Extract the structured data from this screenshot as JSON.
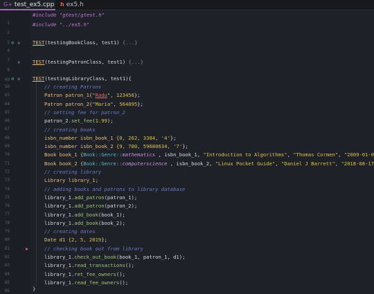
{
  "tabs": [
    {
      "label": "test_ex5.cpp",
      "icon": "cpp-file-icon",
      "active": true
    },
    {
      "label": "ex5.h",
      "icon": "header-file-icon",
      "active": false
    }
  ],
  "line_numbers": [
    "1",
    "2",
    "3",
    "4",
    "7",
    "8",
    "49",
    "50",
    "63",
    "64",
    "65",
    "66",
    "67",
    "68",
    "69",
    "70",
    "71",
    "72",
    "73",
    "74",
    "75",
    "76",
    "77",
    "78",
    "79",
    "80",
    "81",
    "82",
    "83",
    "84",
    "85",
    "86",
    "87",
    "88"
  ],
  "code": {
    "include1": "#include \"gtest/gtest.h\"",
    "include2": "#include \"../ex5.h\"",
    "test1_macro": "TEST",
    "test1_args": "(testingBookClass, test1)",
    "fold": "{...}",
    "test2_macro": "TEST",
    "test2_args": "(testingPatronClass, test1)",
    "test3_macro": "TEST",
    "test3_args": "(testingLibraryClass, test1){",
    "c_patrons": "// creating Patrons",
    "patron1_a": "Patron patron_1{\"",
    "patron1_name": "Radu",
    "patron1_b": "\", ",
    "patron1_num": "123456",
    "patron1_c": "};",
    "patron2_a": "Patron patron_2{\"",
    "patron2_name": "Maria",
    "patron2_b": "\", ",
    "patron2_num": "564895",
    "patron2_c": "};",
    "c_fee": "// setting fee for patron_2",
    "fee_a": "patron_2.",
    "fee_fn": "set_fee",
    "fee_b": "(",
    "fee_num": "1.99",
    "fee_c": ");",
    "c_books": "// creating books",
    "isbn1_a": "isbn_number isbn_book_1 {",
    "isbn1_nums": "0, 262, 3384, '4'",
    "isbn1_c": "};",
    "isbn2_a": "isbn_number isbn_book_2 {",
    "isbn2_nums": "9, 780, 59680634, '7'",
    "isbn2_c": "};",
    "book1_a": "Book book_1 {",
    "book1_ns": "Book::Genre::",
    "book1_genre": "mathematics",
    "book1_b": " , isbn_book_1, ",
    "book1_title": "\"Introduction to Algorithms\"",
    "book1_sep": ", ",
    "book1_author": "\"Thomas Cormen\"",
    "book1_sep2": ", ",
    "book1_date": "\"2009-01-01\"",
    "book1_c": "};",
    "book2_a": "Book book_2 {",
    "book2_ns": "Book::Genre::",
    "book2_genre": "computerscience",
    "book2_b": " , isbn_book_2, ",
    "book2_title": "\"Linux Pocket Guide\"",
    "book2_sep": ", ",
    "book2_author": "\"Daniel J Barrett\"",
    "book2_sep2": ", ",
    "book2_date": "\"2018-08-17\"",
    "book2_c": "};",
    "c_library": "// creating library",
    "library_decl": "Library library_1;",
    "c_adding": "// adding books and patrons to library database",
    "add_p1_a": "library_1.",
    "add_p1_fn": "add_patron",
    "add_p1_b": "(patron_1);",
    "add_p2_a": "library_1.",
    "add_p2_fn": "add_patron",
    "add_p2_b": "(patron_2);",
    "add_b1_a": "library_1.",
    "add_b1_fn": "add_book",
    "add_b1_b": "(book_1);",
    "add_b2_a": "library_1.",
    "add_b2_fn": "add_book",
    "add_b2_b": "(book_2);",
    "c_dates": "// creating dates",
    "date_a": "Date d1 {",
    "date_nums": "2, 5, 2019",
    "date_c": "};",
    "c_checking": "// checking book out from library",
    "co_a": "library_1.",
    "co_fn": "check_out_book",
    "co_b": "(book_1, patron_1, d1);",
    "rt_a": "library_1.",
    "rt_fn": "read_transactions",
    "rt_b": "();",
    "ret_a": "library_1.",
    "ret_fn": "ret_fee_owners",
    "ret_b": "();",
    "rfo_a": "library_1.",
    "rfo_fn": "read_fee_owners",
    "rfo_b": "();",
    "close": "}"
  }
}
